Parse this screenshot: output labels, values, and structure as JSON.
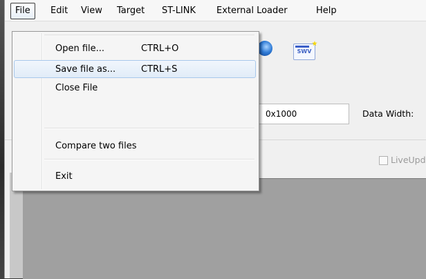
{
  "menubar": {
    "items": [
      {
        "label": "File"
      },
      {
        "label": "Edit"
      },
      {
        "label": "View"
      },
      {
        "label": "Target"
      },
      {
        "label": "ST-LINK"
      },
      {
        "label": "External Loader"
      },
      {
        "label": "Help"
      }
    ]
  },
  "file_menu": {
    "items": [
      {
        "label": "Open file...",
        "shortcut": "CTRL+O"
      },
      {
        "label": "Save file as...",
        "shortcut": "CTRL+S"
      },
      {
        "label": "Close File",
        "shortcut": ""
      },
      {
        "label": "Compare two files",
        "shortcut": ""
      },
      {
        "label": "Exit",
        "shortcut": ""
      }
    ]
  },
  "toolbar": {
    "swv_icon_text": "SWV"
  },
  "memory": {
    "size_value": "0x1000",
    "data_width_label": "Data Width:",
    "live_update_label": "LiveUpdat"
  }
}
